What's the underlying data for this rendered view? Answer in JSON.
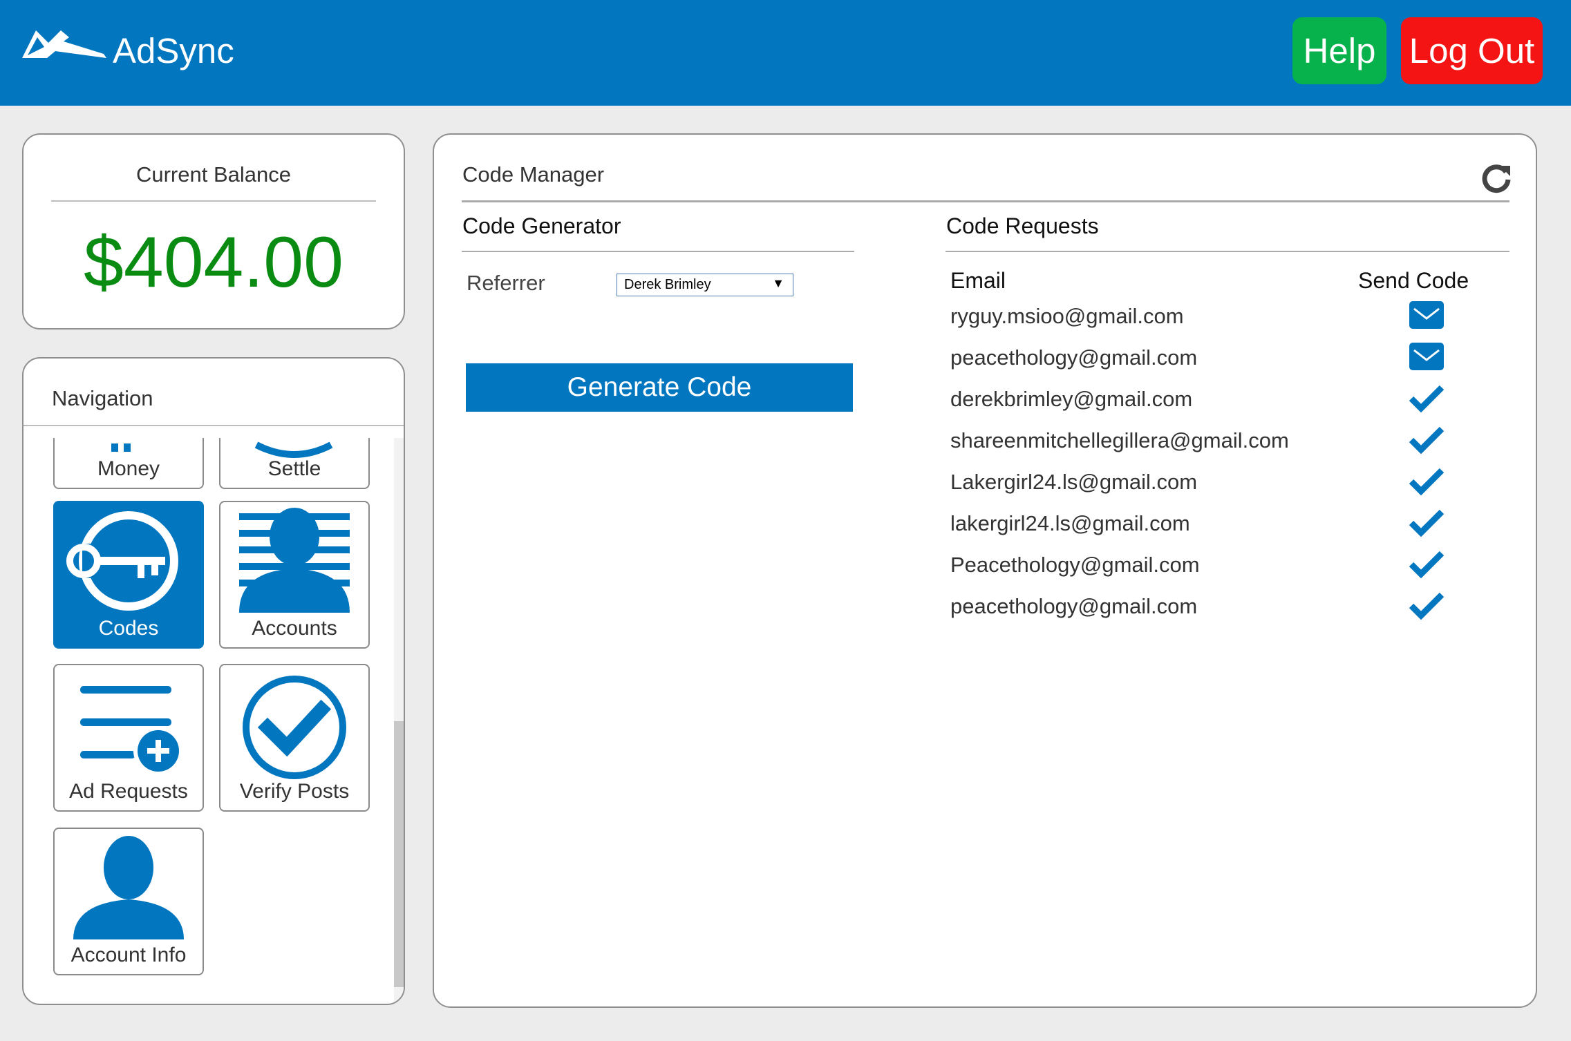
{
  "header": {
    "app_name": "AdSync",
    "help_label": "Help",
    "logout_label": "Log Out",
    "bar_color": "#0277c0"
  },
  "balance": {
    "title": "Current Balance",
    "amount": "$404.00"
  },
  "navigation": {
    "title": "Navigation",
    "items": [
      {
        "label": "Money",
        "icon": "money-icon",
        "active": false
      },
      {
        "label": "Settle",
        "icon": "settle-icon",
        "active": false
      },
      {
        "label": "Codes",
        "icon": "key-icon",
        "active": true
      },
      {
        "label": "Accounts",
        "icon": "accounts-icon",
        "active": false
      },
      {
        "label": "Ad Requests",
        "icon": "ad-requests-icon",
        "active": false
      },
      {
        "label": "Verify Posts",
        "icon": "verify-check-icon",
        "active": false
      },
      {
        "label": "Account Info",
        "icon": "person-icon",
        "active": false
      }
    ]
  },
  "code_manager": {
    "title": "Code Manager",
    "generator": {
      "title": "Code Generator",
      "referrer_label": "Referrer",
      "referrer_value": "Derek Brimley",
      "generate_label": "Generate Code"
    },
    "requests": {
      "title": "Code Requests",
      "columns": [
        "Email",
        "Send Code"
      ],
      "rows": [
        {
          "email": "ryguy.msioo@gmail.com",
          "status": "envelope-icon"
        },
        {
          "email": "peacethology@gmail.com",
          "status": "envelope-icon"
        },
        {
          "email": "derekbrimley@gmail.com",
          "status": "check-icon"
        },
        {
          "email": "shareenmitchellegillera@gmail.com",
          "status": "check-icon"
        },
        {
          "email": "Lakergirl24.ls@gmail.com",
          "status": "check-icon"
        },
        {
          "email": "lakergirl24.ls@gmail.com",
          "status": "check-icon"
        },
        {
          "email": "Peacethology@gmail.com",
          "status": "check-icon"
        },
        {
          "email": "peacethology@gmail.com",
          "status": "check-icon"
        }
      ]
    }
  }
}
